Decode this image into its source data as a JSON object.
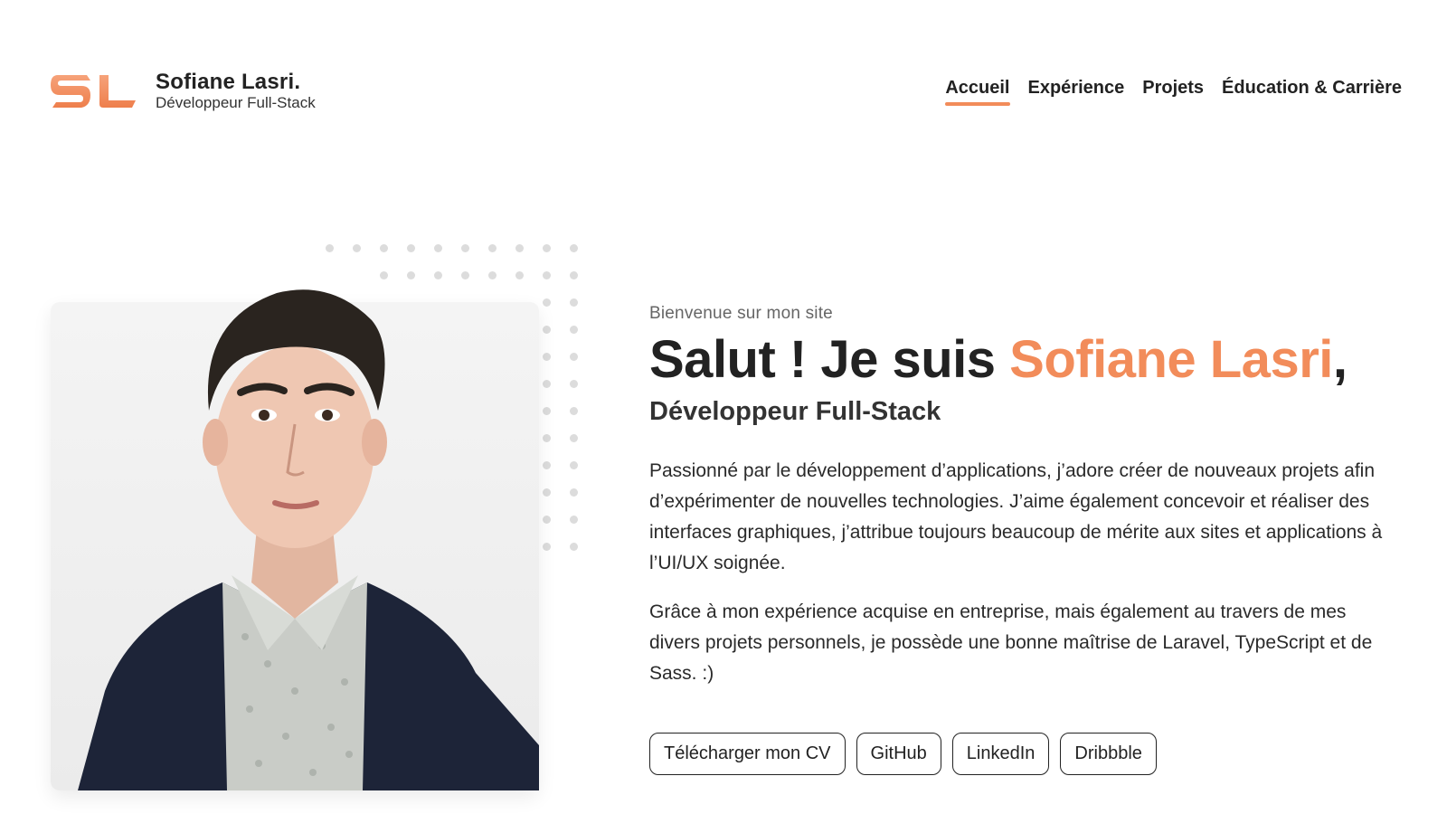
{
  "brand": {
    "name": "Sofiane Lasri.",
    "subtitle": "Développeur Full-Stack",
    "logo_icon": "sl-monogram-logo",
    "accent_color": "#f28c5a"
  },
  "nav": {
    "items": [
      {
        "label": "Accueil",
        "active": true
      },
      {
        "label": "Expérience",
        "active": false
      },
      {
        "label": "Projets",
        "active": false
      },
      {
        "label": "Éducation & Carrière",
        "active": false
      }
    ]
  },
  "hero": {
    "welcome": "Bienvenue sur mon site",
    "headline_prefix": "Salut ! Je suis ",
    "headline_name": "Sofiane Lasri",
    "headline_suffix": ",",
    "role": "Développeur Full-Stack",
    "paragraphs": [
      "Passionné par le développement d’applications, j’adore créer de nouveaux projets afin d’expérimenter de nouvelles technologies. J’aime également concevoir et réaliser des interfaces graphiques, j’attribue toujours beaucoup de mérite aux sites et applications à l’UI/UX soignée.",
      "Grâce à mon expérience acquise en entreprise, mais également au travers de mes divers projets personnels, je possède une bonne maîtrise de Laravel, TypeScript et de Sass. :)"
    ],
    "buttons": [
      {
        "label": "Télécharger mon CV"
      },
      {
        "label": "GitHub"
      },
      {
        "label": "LinkedIn"
      },
      {
        "label": "Dribbble"
      }
    ]
  }
}
